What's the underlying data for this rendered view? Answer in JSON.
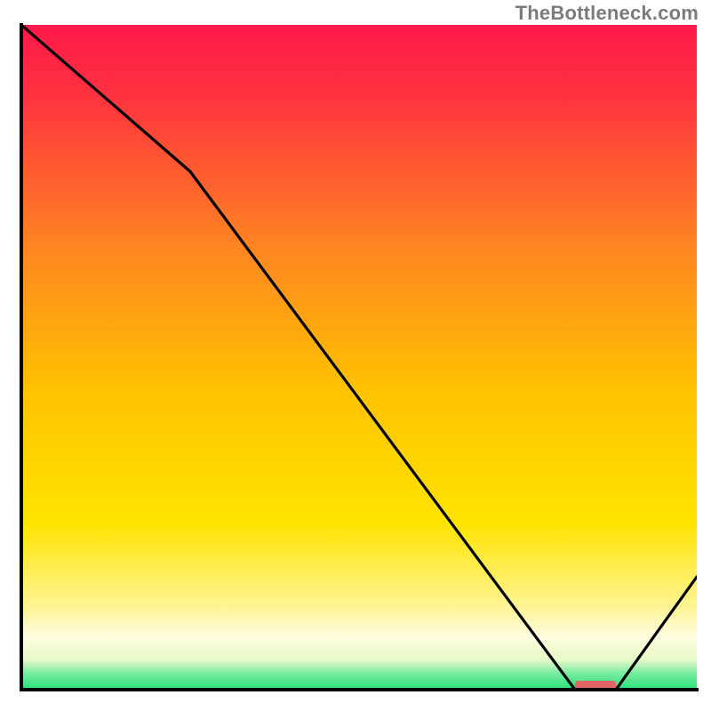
{
  "attribution": "TheBottleneck.com",
  "chart_data": {
    "type": "line",
    "title": "",
    "xlabel": "",
    "ylabel": "",
    "xlim": [
      0,
      100
    ],
    "ylim": [
      0,
      100
    ],
    "grid": false,
    "legend": false,
    "x": [
      0,
      25,
      82,
      88,
      100
    ],
    "y": [
      100,
      78,
      0,
      0,
      17
    ],
    "background_gradient": {
      "top_color": "#ff1a4a",
      "mid_color": "#ffe400",
      "bottom_band_color": "#fffde0",
      "green_band_color": "#28e07a"
    },
    "highlight_segment": {
      "x_start": 82,
      "x_end": 88,
      "color": "#e06666"
    },
    "axes_color": "#000000",
    "line_color": "#000000"
  }
}
